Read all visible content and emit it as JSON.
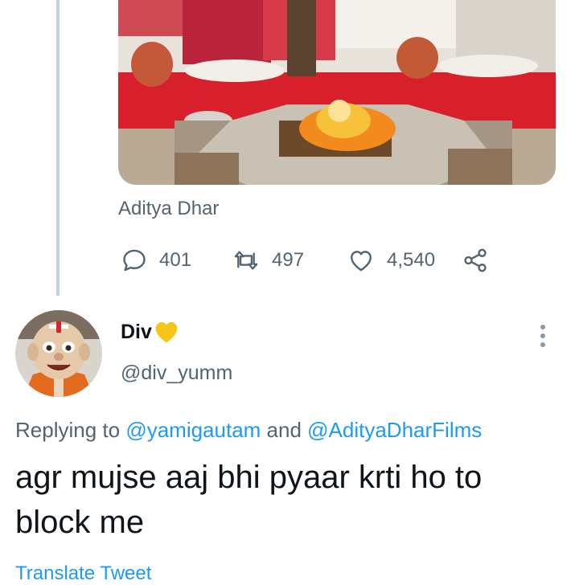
{
  "media": {
    "caption": "Aditya Dhar"
  },
  "actions": {
    "reply": {
      "icon": "reply-icon",
      "count": "401"
    },
    "retweet": {
      "icon": "retweet-icon",
      "count": "497"
    },
    "like": {
      "icon": "heart-outline-icon",
      "count": "4,540"
    },
    "share": {
      "icon": "share-icon"
    }
  },
  "reply": {
    "display_name": "Div",
    "name_emoji": "yellow-heart",
    "handle": "@div_yumm",
    "replying_prefix": "Replying to ",
    "mention_1": "@yamigautam",
    "replying_and": " and ",
    "mention_2": "@AdityaDharFilms",
    "text": "agr mujse aaj bhi pyaar krti ho to block me",
    "translate_label": "Translate Tweet"
  },
  "colors": {
    "muted_text": "#536471",
    "link_blue": "#1d9bf0",
    "thread_line": "#c9d1d8",
    "heart_emoji": "#f7c419"
  }
}
